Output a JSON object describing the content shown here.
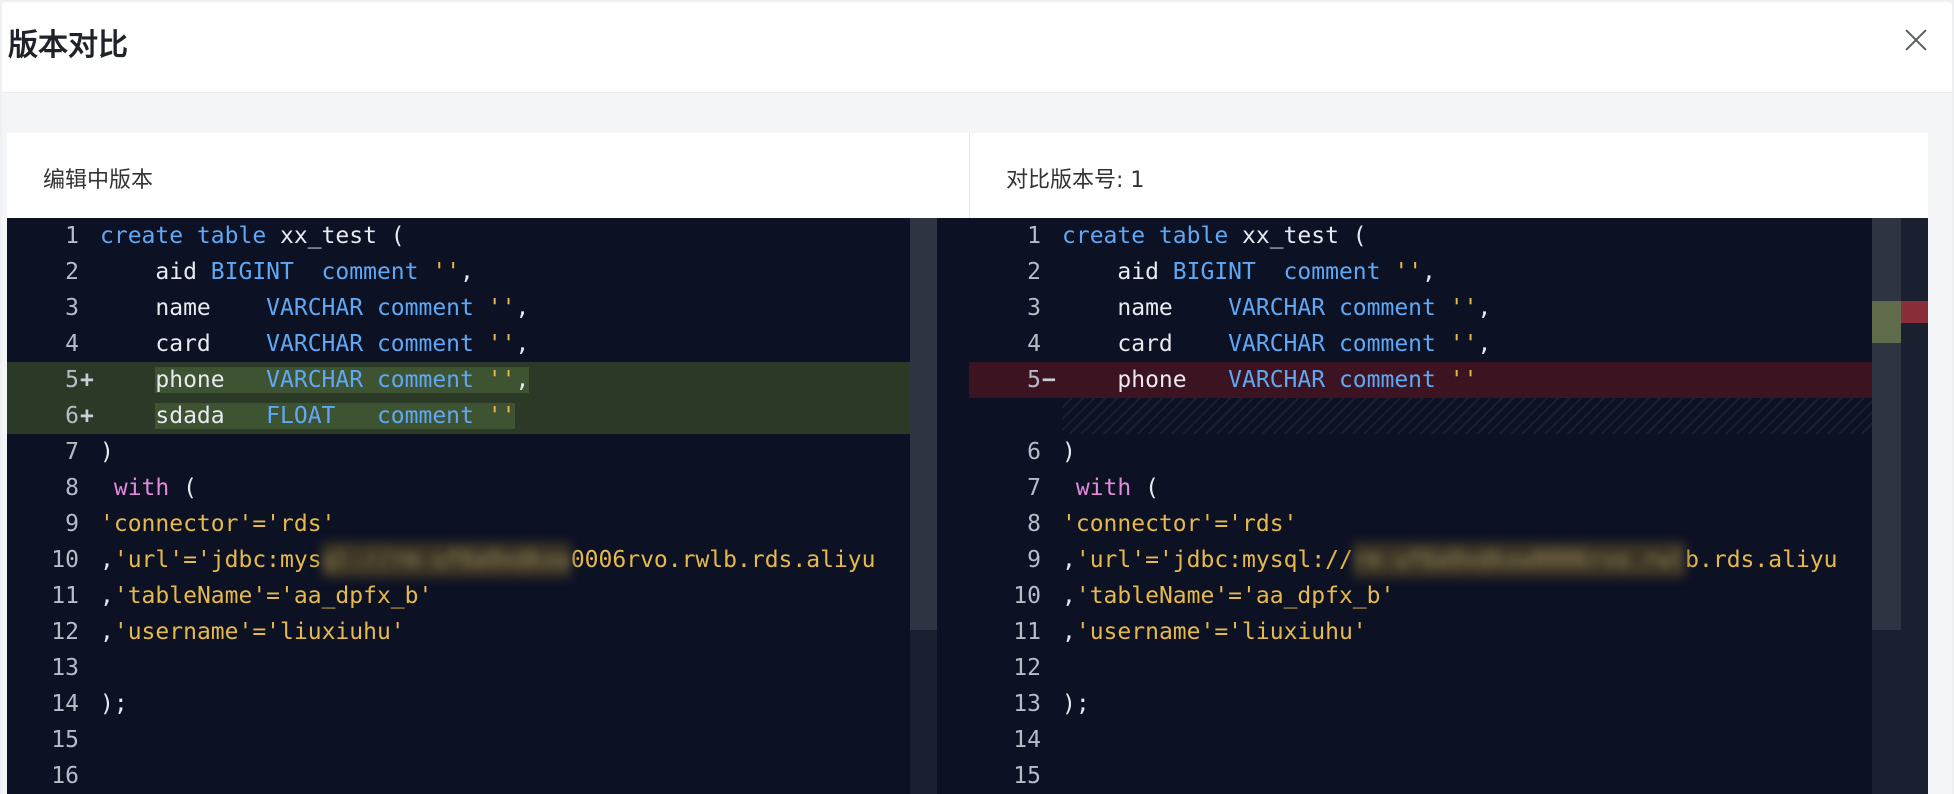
{
  "modal": {
    "title": "版本对比"
  },
  "panes": {
    "left_title": "编辑中版本",
    "right_title": "对比版本号: 1"
  },
  "left_lines": [
    {
      "num": "1",
      "marker": "",
      "parts": [
        [
          "kw",
          "create table"
        ],
        [
          "",
          "xx_test ("
        ]
      ]
    },
    {
      "num": "2",
      "marker": "",
      "parts": [
        [
          "",
          "    aid "
        ],
        [
          "kw",
          "BIGINT  comment"
        ],
        [
          "str",
          " ''"
        ],
        [
          "",
          ","
        ]
      ]
    },
    {
      "num": "3",
      "marker": "",
      "parts": [
        [
          "",
          "    name    "
        ],
        [
          "kw",
          "VARCHAR comment"
        ],
        [
          "str",
          " ''"
        ],
        [
          "",
          ","
        ]
      ]
    },
    {
      "num": "4",
      "marker": "",
      "parts": [
        [
          "",
          "    card    "
        ],
        [
          "kw",
          "VARCHAR comment"
        ],
        [
          "str",
          " ''"
        ],
        [
          "",
          ","
        ]
      ]
    },
    {
      "num": "5",
      "marker": "+",
      "parts": [
        [
          "",
          "    phone   "
        ],
        [
          "kw",
          "VARCHAR comment"
        ],
        [
          "str",
          " ''"
        ],
        [
          "",
          ","
        ]
      ]
    },
    {
      "num": "6",
      "marker": "+",
      "parts": [
        [
          "",
          "    sdada   "
        ],
        [
          "kw",
          "FLOAT   comment"
        ],
        [
          "str",
          " ''"
        ]
      ]
    },
    {
      "num": "7",
      "marker": "",
      "parts": [
        [
          "",
          ")"
        ]
      ]
    },
    {
      "num": "8",
      "marker": "",
      "parts": [
        [
          "pink",
          " with"
        ],
        [
          "",
          " ("
        ]
      ]
    },
    {
      "num": "9",
      "marker": "",
      "parts": [
        [
          "str",
          "'connector'='rds'"
        ]
      ]
    },
    {
      "num": "10",
      "marker": "",
      "parts": [
        [
          "",
          ","
        ],
        [
          "str",
          "'url'='jdbc:mys"
        ],
        [
          "blur",
          "ql://rm-uf6a9xdkxw"
        ],
        [
          "str",
          "0006rvo.rwlb.rds.aliyu"
        ]
      ]
    },
    {
      "num": "11",
      "marker": "",
      "parts": [
        [
          "",
          ","
        ],
        [
          "str",
          "'tableName'='aa_dpfx_b'"
        ]
      ]
    },
    {
      "num": "12",
      "marker": "",
      "parts": [
        [
          "",
          ","
        ],
        [
          "str",
          "'username'='liuxiuhu'"
        ]
      ]
    },
    {
      "num": "13",
      "marker": "",
      "parts": []
    },
    {
      "num": "14",
      "marker": "",
      "parts": [
        [
          "",
          ");"
        ]
      ]
    },
    {
      "num": "15",
      "marker": "",
      "parts": []
    },
    {
      "num": "16",
      "marker": "",
      "parts": []
    }
  ],
  "right_lines": [
    {
      "num": "1",
      "marker": "",
      "parts": [
        [
          "kw",
          "create table"
        ],
        [
          "",
          "xx_test ("
        ]
      ]
    },
    {
      "num": "2",
      "marker": "",
      "parts": [
        [
          "",
          "    aid "
        ],
        [
          "kw",
          "BIGINT  comment"
        ],
        [
          "str",
          " ''"
        ],
        [
          "",
          ","
        ]
      ]
    },
    {
      "num": "3",
      "marker": "",
      "parts": [
        [
          "",
          "    name    "
        ],
        [
          "kw",
          "VARCHAR comment"
        ],
        [
          "str",
          " ''"
        ],
        [
          "",
          ","
        ]
      ]
    },
    {
      "num": "4",
      "marker": "",
      "parts": [
        [
          "",
          "    card    "
        ],
        [
          "kw",
          "VARCHAR comment"
        ],
        [
          "str",
          " ''"
        ],
        [
          "",
          ","
        ]
      ]
    },
    {
      "num": "5",
      "marker": "−",
      "parts": [
        [
          "",
          "    phone   "
        ],
        [
          "kw",
          "VARCHAR comment"
        ],
        [
          "str",
          " ''"
        ]
      ]
    },
    {
      "num": "",
      "marker": "",
      "parts": []
    },
    {
      "num": "6",
      "marker": "",
      "parts": [
        [
          "",
          ")"
        ]
      ]
    },
    {
      "num": "7",
      "marker": "",
      "parts": [
        [
          "pink",
          " with"
        ],
        [
          "",
          " ("
        ]
      ]
    },
    {
      "num": "8",
      "marker": "",
      "parts": [
        [
          "str",
          "'connector'='rds'"
        ]
      ]
    },
    {
      "num": "9",
      "marker": "",
      "parts": [
        [
          "",
          ","
        ],
        [
          "str",
          "'url'='jdbc:mysql://"
        ],
        [
          "blur",
          "rm-uf6a9xdkxw0006rvo.rwl"
        ],
        [
          "str",
          "b.rds.aliyu"
        ]
      ]
    },
    {
      "num": "10",
      "marker": "",
      "parts": [
        [
          "",
          ","
        ],
        [
          "str",
          "'tableName'='aa_dpfx_b'"
        ]
      ]
    },
    {
      "num": "11",
      "marker": "",
      "parts": [
        [
          "",
          ","
        ],
        [
          "str",
          "'username'='liuxiuhu'"
        ]
      ]
    },
    {
      "num": "12",
      "marker": "",
      "parts": []
    },
    {
      "num": "13",
      "marker": "",
      "parts": [
        [
          "",
          ");"
        ]
      ]
    },
    {
      "num": "14",
      "marker": "",
      "parts": []
    },
    {
      "num": "15",
      "marker": "",
      "parts": []
    }
  ],
  "colors": {
    "editor_bg": "#0c1124",
    "keyword": "#5fa8f5",
    "string": "#e6b94a",
    "with_keyword": "#e38ad9",
    "added_line": "#2b3a27",
    "removed_line": "#3c1320"
  }
}
